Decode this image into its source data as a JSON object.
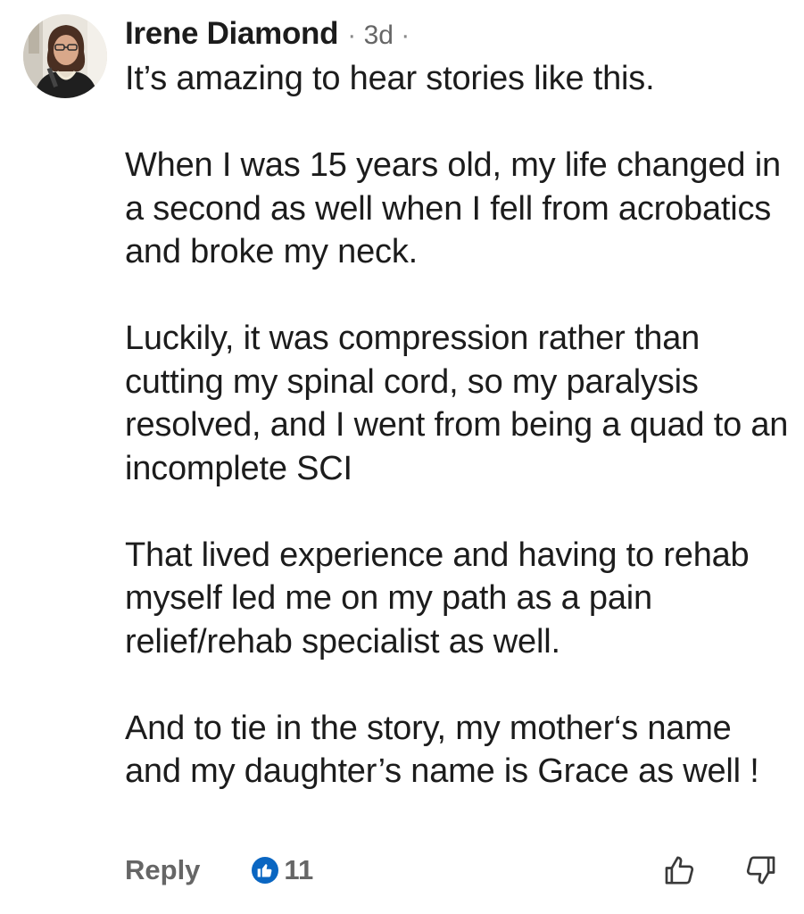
{
  "comment": {
    "author": "Irene Diamond",
    "separator": "·",
    "time": "3d",
    "paragraphs": [
      "It’s amazing to hear stories like this.",
      "When I was 15 years old, my life changed in a second as well when I fell from acrobatics and broke my neck.",
      "Luckily, it was compression rather than cutting my spinal cord, so my paralysis resolved, and I went from being a quad to an incomplete SCI",
      "That lived experience and having to rehab myself led me on my path as a pain relief/rehab specialist as well.",
      "And to tie in the story, my mother‘s name and my daughter’s name is Grace as well !"
    ]
  },
  "actions": {
    "reply_label": "Reply",
    "reaction_count": "11",
    "reaction_icon": "thumbs-up-icon",
    "upvote_icon": "thumbs-up-outline-icon",
    "downvote_icon": "thumbs-down-outline-icon"
  },
  "colors": {
    "text": "#1c1c1c",
    "muted": "#666666",
    "like_blue": "#0a66c2",
    "background": "#ffffff"
  }
}
